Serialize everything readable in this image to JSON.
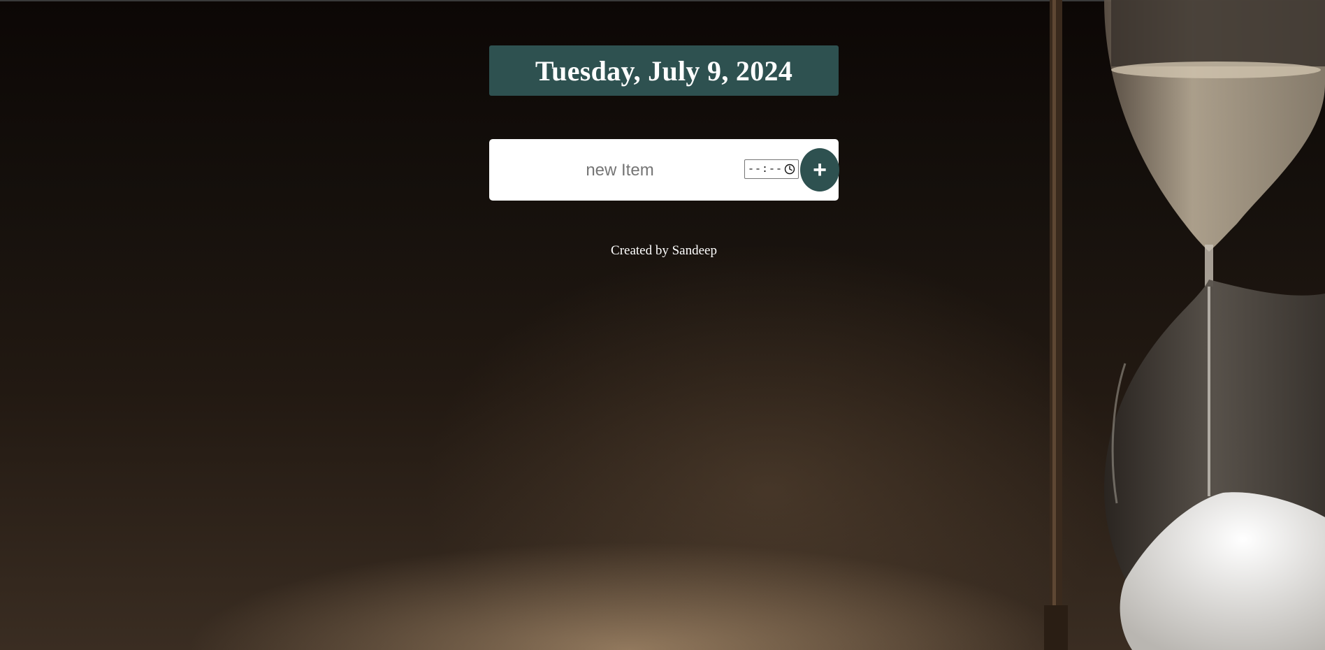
{
  "header": {
    "date": "Tuesday, July 9, 2024"
  },
  "form": {
    "item_placeholder": "new Item",
    "item_value": "",
    "time_value": "--:--",
    "add_label": "+"
  },
  "footer": {
    "credit": "Created by Sandeep"
  },
  "icons": {
    "time": "clock-icon",
    "add": "plus-icon"
  },
  "colors": {
    "accent": "#2e5150",
    "card": "#ffffff",
    "text_light": "#ffffff"
  }
}
